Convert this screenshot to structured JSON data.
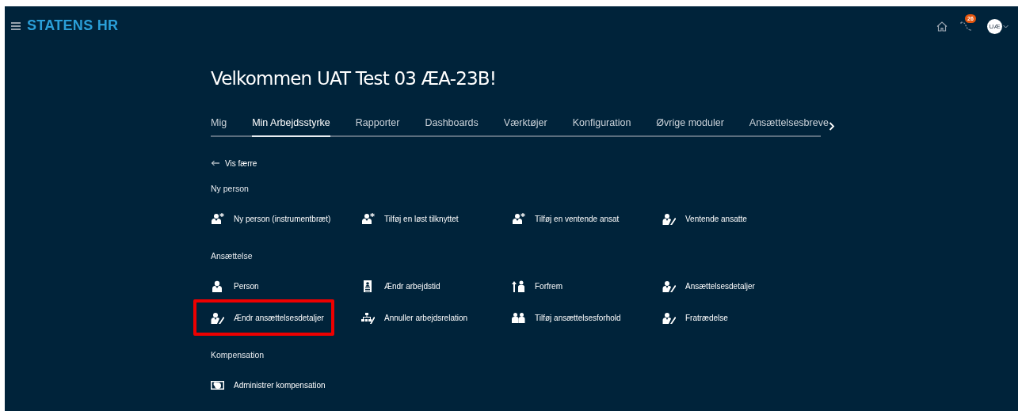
{
  "header": {
    "title": "STATENS HR",
    "notification_count": "26",
    "avatar_initials": "UÆ"
  },
  "welcome": "Velkommen UAT Test 03 ÆA-23B!",
  "tabs": [
    {
      "label": "Mig",
      "selected": false
    },
    {
      "label": "Min Arbejdsstyrke",
      "selected": true
    },
    {
      "label": "Rapporter",
      "selected": false
    },
    {
      "label": "Dashboards",
      "selected": false
    },
    {
      "label": "Værktøjer",
      "selected": false
    },
    {
      "label": "Konfiguration",
      "selected": false
    },
    {
      "label": "Øvrige moduler",
      "selected": false
    },
    {
      "label": "Ansættelsesbreve",
      "selected": false
    }
  ],
  "show_less": "Vis færre",
  "sections": [
    {
      "title": "Ny person",
      "items": [
        {
          "label": "Ny person (instrumentbræt)",
          "kind": "addperson",
          "highlighted": false
        },
        {
          "label": "Tilføj en løst tilknyttet",
          "kind": "addperson",
          "highlighted": false
        },
        {
          "label": "Tilføj en ventende ansat",
          "kind": "addperson",
          "highlighted": false
        },
        {
          "label": "Ventende ansatte",
          "kind": "editperson",
          "highlighted": false
        }
      ]
    },
    {
      "title": "Ansættelse",
      "items": [
        {
          "label": "Person",
          "kind": "person",
          "highlighted": false
        },
        {
          "label": "Ændr arbejdstid",
          "kind": "card",
          "highlighted": false
        },
        {
          "label": "Forfrem",
          "kind": "promote",
          "highlighted": false
        },
        {
          "label": "Ansættelsesdetaljer",
          "kind": "editperson",
          "highlighted": false
        },
        {
          "label": "Ændr ansættelsesdetaljer",
          "kind": "editperson",
          "highlighted": true
        },
        {
          "label": "Annuller arbejdsrelation",
          "kind": "org",
          "highlighted": false
        },
        {
          "label": "Tilføj ansættelsesforhold",
          "kind": "group",
          "highlighted": false
        },
        {
          "label": "Fratrædelse",
          "kind": "editperson",
          "highlighted": false
        }
      ]
    },
    {
      "title": "Kompensation",
      "items": [
        {
          "label": "Administrer kompensation",
          "kind": "money",
          "highlighted": false
        }
      ]
    }
  ]
}
